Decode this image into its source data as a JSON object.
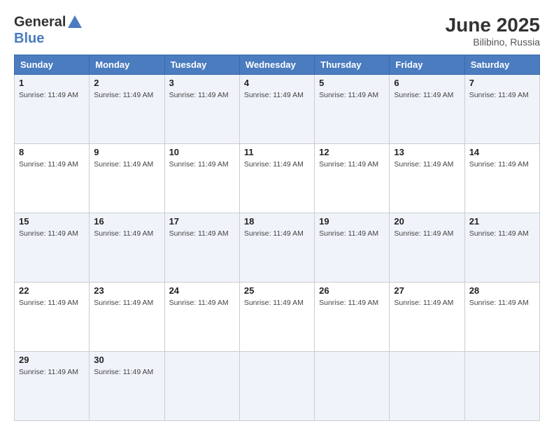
{
  "header": {
    "logo_line1": "General",
    "logo_line2": "Blue",
    "month_title": "June 2025",
    "location": "Bilibino, Russia"
  },
  "days_of_week": [
    "Sunday",
    "Monday",
    "Tuesday",
    "Wednesday",
    "Thursday",
    "Friday",
    "Saturday"
  ],
  "sunrise_text": "Sunrise: 11:49 AM",
  "weeks": [
    [
      {
        "day": "1",
        "sunrise": "Sunrise: 11:49 AM"
      },
      {
        "day": "2",
        "sunrise": "Sunrise: 11:49 AM"
      },
      {
        "day": "3",
        "sunrise": "Sunrise: 11:49 AM"
      },
      {
        "day": "4",
        "sunrise": "Sunrise: 11:49 AM"
      },
      {
        "day": "5",
        "sunrise": "Sunrise: 11:49 AM"
      },
      {
        "day": "6",
        "sunrise": "Sunrise: 11:49 AM"
      },
      {
        "day": "7",
        "sunrise": "Sunrise: 11:49 AM"
      }
    ],
    [
      {
        "day": "8",
        "sunrise": "Sunrise: 11:49 AM"
      },
      {
        "day": "9",
        "sunrise": "Sunrise: 11:49 AM"
      },
      {
        "day": "10",
        "sunrise": "Sunrise: 11:49 AM"
      },
      {
        "day": "11",
        "sunrise": "Sunrise: 11:49 AM"
      },
      {
        "day": "12",
        "sunrise": "Sunrise: 11:49 AM"
      },
      {
        "day": "13",
        "sunrise": "Sunrise: 11:49 AM"
      },
      {
        "day": "14",
        "sunrise": "Sunrise: 11:49 AM"
      }
    ],
    [
      {
        "day": "15",
        "sunrise": "Sunrise: 11:49 AM"
      },
      {
        "day": "16",
        "sunrise": "Sunrise: 11:49 AM"
      },
      {
        "day": "17",
        "sunrise": "Sunrise: 11:49 AM"
      },
      {
        "day": "18",
        "sunrise": "Sunrise: 11:49 AM"
      },
      {
        "day": "19",
        "sunrise": "Sunrise: 11:49 AM"
      },
      {
        "day": "20",
        "sunrise": "Sunrise: 11:49 AM"
      },
      {
        "day": "21",
        "sunrise": "Sunrise: 11:49 AM"
      }
    ],
    [
      {
        "day": "22",
        "sunrise": "Sunrise: 11:49 AM"
      },
      {
        "day": "23",
        "sunrise": "Sunrise: 11:49 AM"
      },
      {
        "day": "24",
        "sunrise": "Sunrise: 11:49 AM"
      },
      {
        "day": "25",
        "sunrise": "Sunrise: 11:49 AM"
      },
      {
        "day": "26",
        "sunrise": "Sunrise: 11:49 AM"
      },
      {
        "day": "27",
        "sunrise": "Sunrise: 11:49 AM"
      },
      {
        "day": "28",
        "sunrise": "Sunrise: 11:49 AM"
      }
    ],
    [
      {
        "day": "29",
        "sunrise": "Sunrise: 11:49 AM"
      },
      {
        "day": "30",
        "sunrise": "Sunrise: 11:49 AM"
      },
      {
        "day": "",
        "sunrise": ""
      },
      {
        "day": "",
        "sunrise": ""
      },
      {
        "day": "",
        "sunrise": ""
      },
      {
        "day": "",
        "sunrise": ""
      },
      {
        "day": "",
        "sunrise": ""
      }
    ]
  ]
}
